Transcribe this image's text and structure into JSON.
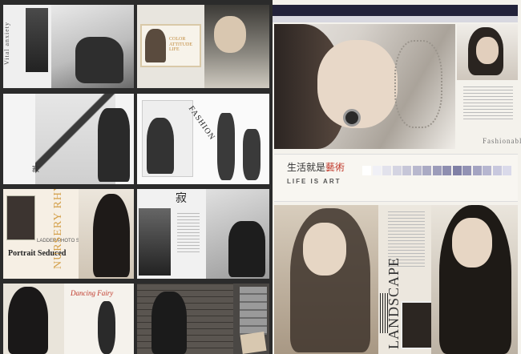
{
  "collage": {
    "tiles": [
      {
        "text": "Vital anxiety"
      },
      {
        "text": "COLOR ATTITUDE LIFE"
      },
      {
        "text": ""
      },
      {
        "text": "FASHION"
      },
      {
        "text": "LADDER PHOTO STUD",
        "text2": "NURSERY RHYME",
        "text3": "Portrait Seduced"
      },
      {
        "text": "寂"
      },
      {
        "text": "Dancing Fairy"
      },
      {
        "text": ""
      }
    ]
  },
  "right_panel": {
    "top_photo_caption": "Fashionable",
    "banner_cn_1": "生活就是",
    "banner_cn_2": "藝術",
    "banner_en": "LIFE IS ART",
    "swatches": [
      "#ffffff",
      "#f0f0f6",
      "#e2e2ec",
      "#d4d4e2",
      "#c6c6d8",
      "#b8b8ce",
      "#aaaac4",
      "#9c9cba",
      "#8e8eb0",
      "#8080a6",
      "#9292b4",
      "#a4a4c2",
      "#b6b6d0",
      "#c8c8de",
      "#dadaea"
    ],
    "landscape_label": "LANDSCAPE"
  },
  "colors": {
    "bg": "#2b2b2b",
    "accent_red": "#c0392b",
    "accent_gold": "#d4a04a",
    "panel": "#f4f2ec"
  }
}
